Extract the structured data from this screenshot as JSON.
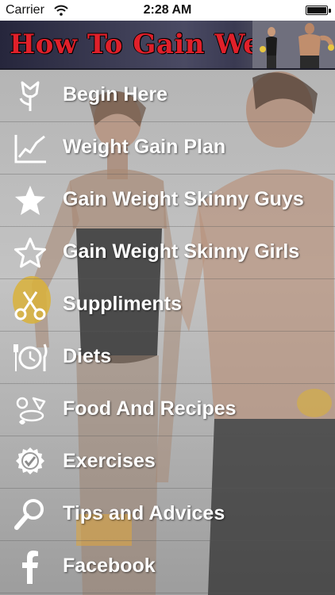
{
  "status_bar": {
    "carrier": "Carrier",
    "time": "2:28 AM"
  },
  "banner": {
    "title": "How To Gain Weight"
  },
  "menu": {
    "items": [
      {
        "label": "Begin Here",
        "icon": "tulip-icon"
      },
      {
        "label": "Weight Gain Plan",
        "icon": "line-chart-icon"
      },
      {
        "label": "Gain Weight Skinny Guys",
        "icon": "star-filled-icon"
      },
      {
        "label": "Gain Weight Skinny Girls",
        "icon": "star-outline-icon"
      },
      {
        "label": "Suppliments",
        "icon": "scissors-icon"
      },
      {
        "label": "Diets",
        "icon": "plate-clock-icon"
      },
      {
        "label": "Food And Recipes",
        "icon": "food-icon"
      },
      {
        "label": "Exercises",
        "icon": "badge-check-icon"
      },
      {
        "label": "Tips and Advices",
        "icon": "magnifier-icon"
      },
      {
        "label": "Facebook",
        "icon": "facebook-icon"
      }
    ]
  },
  "colors": {
    "label_text": "#ffffff",
    "banner_title": "#e0202a",
    "banner_bg": "#2e2e46",
    "menu_bg": "#bdbdbd"
  }
}
